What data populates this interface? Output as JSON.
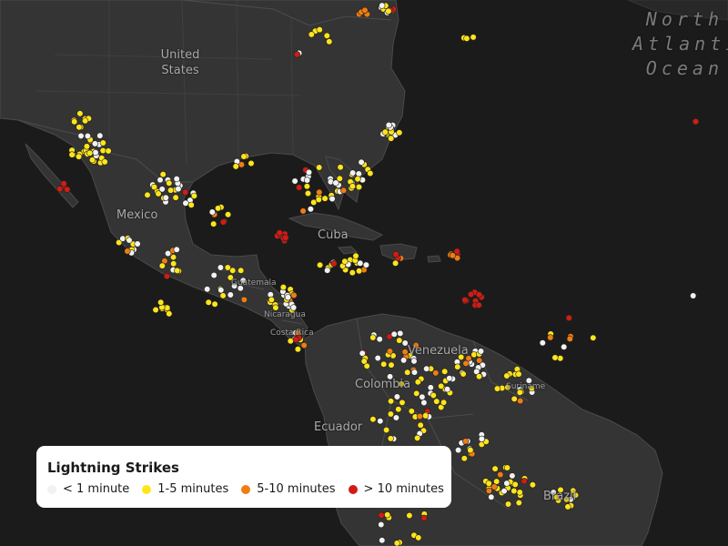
{
  "map": {
    "labels": {
      "us": "United\nStates",
      "mexico": "Mexico",
      "cuba": "Cuba",
      "guatemala": "Guatemala",
      "nicaragua": "Nicaragua",
      "costa_rica": "Costa Rica",
      "venezuela": "Venezuela",
      "colombia": "Colombia",
      "suriname": "Suriname",
      "ecuador": "Ecuador",
      "brazil": "Brazil",
      "ocean": "North\nAtlantic\nOcean"
    }
  },
  "legend": {
    "title": "Lightning Strikes",
    "items": [
      {
        "label": "< 1 minute",
        "color": "#f2f2f2"
      },
      {
        "label": "1-5 minutes",
        "color": "#ffe51a"
      },
      {
        "label": "5-10 minutes",
        "color": "#f07d12"
      },
      {
        "label": "> 10 minutes",
        "color": "#d01c14"
      }
    ]
  },
  "colors": {
    "ocean": "#1b1b1b",
    "land": "#343434",
    "border": "#4a4a4a"
  }
}
